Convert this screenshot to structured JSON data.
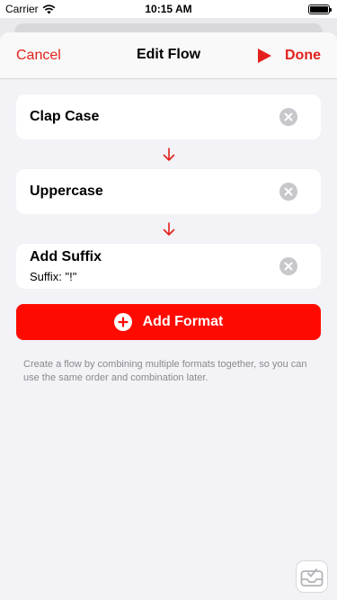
{
  "status_bar": {
    "carrier": "Carrier",
    "time": "10:15 AM",
    "icons": [
      "wifi-icon",
      "battery-icon"
    ]
  },
  "nav": {
    "cancel_label": "Cancel",
    "title": "Edit Flow",
    "play_icon": "play-icon",
    "done_label": "Done"
  },
  "steps": [
    {
      "title": "Clap Case",
      "subtitle": ""
    },
    {
      "title": "Uppercase",
      "subtitle": ""
    },
    {
      "title": "Add Suffix",
      "subtitle": "Suffix: \"!\""
    }
  ],
  "add_format": {
    "label": "Add Format",
    "icon": "plus-circle-icon"
  },
  "footer_note": "Create a flow by combining multiple formats together, so you can use the same order and combination later.",
  "colors": {
    "accent": "#e3201b",
    "button": "#ff0a00",
    "background": "#f2f2f7",
    "card": "#ffffff",
    "secondary_text": "#8a8a8e"
  }
}
